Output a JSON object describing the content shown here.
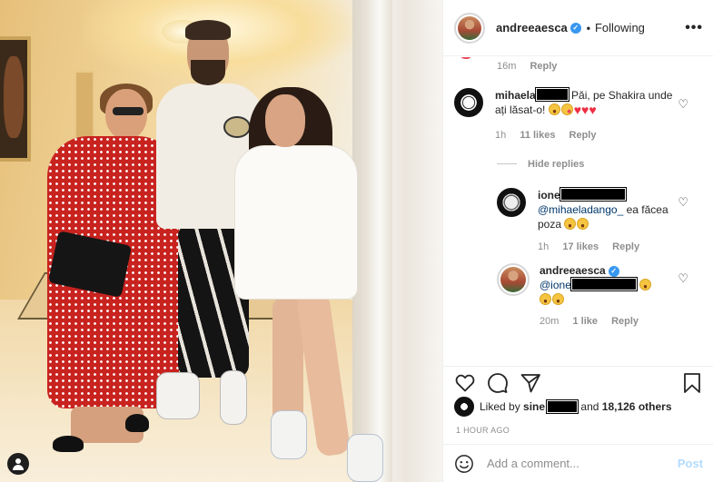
{
  "post": {
    "author": "andreeaesca",
    "follow_status": "Following",
    "more_icon": "more-horizontal-icon"
  },
  "comments": {
    "prev_meta": {
      "time": "16m",
      "reply": "Reply"
    },
    "c1": {
      "user": "mihaela",
      "text": "Păi, pe Shakira unde ați lăsat-o!",
      "time": "1h",
      "likes": "11 likes",
      "reply": "Reply"
    },
    "hide_replies": "Hide replies",
    "r1": {
      "user": "ione",
      "mention": "@mihaeladango_",
      "text": "ea făcea poza",
      "time": "1h",
      "likes": "17 likes",
      "reply": "Reply"
    },
    "r2": {
      "user": "andreeaesca",
      "mention": "@ione",
      "time": "20m",
      "likes": "1 like",
      "reply": "Reply"
    }
  },
  "actions": {
    "liked_by_prefix": "Liked by",
    "liked_by_user": "sine",
    "liked_by_and": "and",
    "others": "18,126 others",
    "time_ago": "1 HOUR AGO"
  },
  "composer": {
    "placeholder": "Add a comment...",
    "post_label": "Post"
  },
  "colors": {
    "link": "#00376b",
    "verified": "#3897f0",
    "post_disabled": "#b3dbff",
    "heart": "#ed2f44"
  }
}
